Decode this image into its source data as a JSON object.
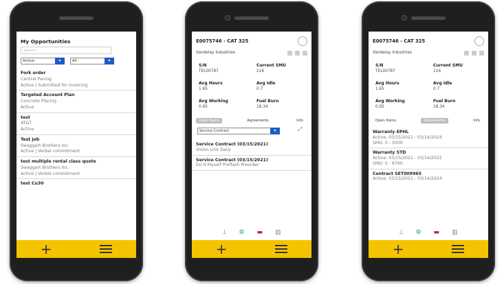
{
  "screen1": {
    "title": "My Opportunities",
    "search_placeholder": "Search...",
    "filter_status": "Active",
    "filter_scope": "All",
    "items": [
      {
        "name": "Fork order",
        "company": "Central Paving",
        "status": "Active | Submitted for invoicing"
      },
      {
        "name": "Targeted Account Plan",
        "company": "Concrete Placing",
        "status": "Active"
      },
      {
        "name": "test",
        "company": "AT&T",
        "status": "Active"
      },
      {
        "name": "Test job",
        "company": "Swaggart Brothers Inc.",
        "status": "Active | Verbal commitment"
      },
      {
        "name": "test multiple rental class quote",
        "company": "Swaggart Brothers Inc.",
        "status": "Active | Verbal commitment"
      },
      {
        "name": "test Cu30",
        "company": "",
        "status": ""
      }
    ]
  },
  "screen2": {
    "title": "E0075746 - CAT 325",
    "company": "Vandelay Industries",
    "fields": [
      {
        "label": "S/N",
        "value": "TEL00787"
      },
      {
        "label": "Current SMU",
        "value": "116"
      },
      {
        "label": "Avg Hours",
        "value": "1.65"
      },
      {
        "label": "Avg Idle",
        "value": "0.7"
      },
      {
        "label": "Avg Working",
        "value": "0.95"
      },
      {
        "label": "Fuel Burn",
        "value": "18.34"
      }
    ],
    "tabs": [
      "Open Items",
      "Agreements",
      "Info"
    ],
    "active_tab": "Open Items",
    "dropdown": "Service Contract",
    "records": [
      {
        "title": "Service Contract (03/15/2021)",
        "sub": "Vision Link Daily"
      },
      {
        "title": "Service Contract (03/15/2021)",
        "sub": "Do It Myself Preflash Preorder"
      }
    ]
  },
  "screen3": {
    "title": "E0075746 - CAT 325",
    "company": "Vandelay Industries",
    "fields": [
      {
        "label": "S/N",
        "value": "TEL00787"
      },
      {
        "label": "Current SMU",
        "value": "116"
      },
      {
        "label": "Avg Hours",
        "value": "1.65"
      },
      {
        "label": "Avg Idle",
        "value": "0.7"
      },
      {
        "label": "Avg Working",
        "value": "0.95"
      },
      {
        "label": "Fuel Burn",
        "value": "18.34"
      }
    ],
    "tabs": [
      "Open Items",
      "Agreements",
      "Info"
    ],
    "active_tab": "Agreements",
    "records": [
      {
        "title": "Warranty EPHL",
        "line1": "Active: 03/15/2021 - 03/14/2024",
        "line2": "SMU: 0 - 5000"
      },
      {
        "title": "Warranty STD",
        "line1": "Active: 03/15/2021 - 03/14/2022",
        "line2": "SMU: 0 - 8760"
      },
      {
        "title": "Contract SET009965",
        "line1": "Active: 03/15/2021 - 03/14/2024",
        "line2": ""
      }
    ]
  },
  "bottom_bar": {
    "add_icon": "plus-icon",
    "menu_icon": "hamburger-icon",
    "color": "#f5c400"
  },
  "colors": {
    "accent_blue": "#1e5bc6"
  }
}
